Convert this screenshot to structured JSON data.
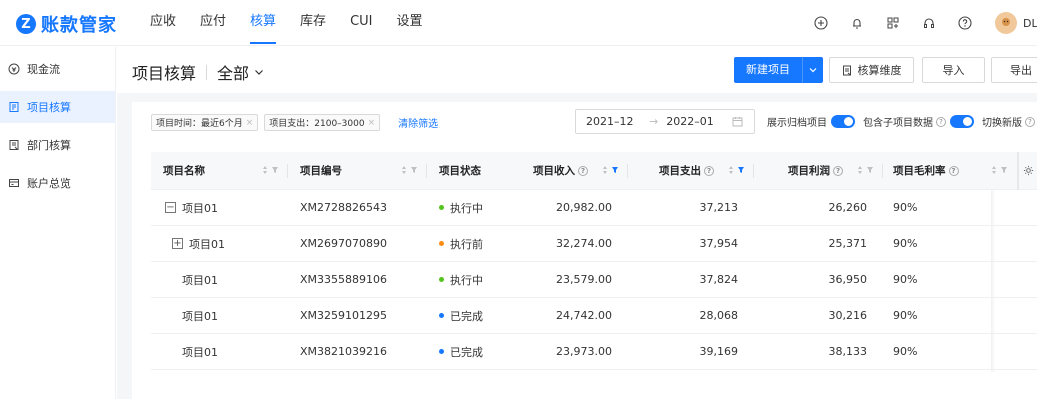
{
  "app": {
    "logo_letter": "Z",
    "title": "账款管家",
    "brand_color": "#1677ff"
  },
  "nav": {
    "items": [
      "应收",
      "应付",
      "核算",
      "库存",
      "CUI",
      "设置"
    ],
    "active": "核算"
  },
  "user": {
    "name": "DL"
  },
  "sidebar": {
    "items": [
      {
        "label": "现金流",
        "icon": "cash-icon"
      },
      {
        "label": "项目核算",
        "icon": "project-icon",
        "active": true
      },
      {
        "label": "部门核算",
        "icon": "department-icon"
      },
      {
        "label": "账户总览",
        "icon": "account-icon"
      }
    ]
  },
  "header": {
    "title": "项目核算",
    "scope": "全部",
    "new_button": "新建项目",
    "dimension_button": "核算维度",
    "import_button": "导入",
    "export_button": "导出"
  },
  "filters": {
    "chips": [
      "项目时间：最近6个月",
      "项目支出：2100–3000"
    ],
    "clear": "清除筛选"
  },
  "date_range": {
    "start": "2021–12",
    "end": "2022–01"
  },
  "switches": {
    "archived": "展示归档项目",
    "include_children": "包含子项目数据",
    "new_version": "切换新版"
  },
  "table": {
    "headers": [
      "项目名称",
      "项目编号",
      "项目状态",
      "项目收入",
      "项目支出",
      "项目利润",
      "项目毛利率"
    ],
    "rows": [
      {
        "name": "项目01",
        "code": "XM2728826543",
        "status": "执行中",
        "status_color": "#52c41a",
        "income": "20,982.00",
        "expense": "37,213",
        "profit": "26,260",
        "margin": "90%",
        "expander": "−",
        "indent": 0
      },
      {
        "name": "项目01",
        "code": "XM2697070890",
        "status": "执行前",
        "status_color": "#fa8c16",
        "income": "32,274.00",
        "expense": "37,954",
        "profit": "25,371",
        "margin": "90%",
        "expander": "+",
        "indent": 1
      },
      {
        "name": "项目01",
        "code": "XM3355889106",
        "status": "执行中",
        "status_color": "#52c41a",
        "income": "23,579.00",
        "expense": "37,824",
        "profit": "36,950",
        "margin": "90%",
        "expander": "",
        "indent": 2
      },
      {
        "name": "项目01",
        "code": "XM3259101295",
        "status": "已完成",
        "status_color": "#1677ff",
        "income": "24,742.00",
        "expense": "28,068",
        "profit": "30,216",
        "margin": "90%",
        "expander": "",
        "indent": 2
      },
      {
        "name": "项目01",
        "code": "XM3821039216",
        "status": "已完成",
        "status_color": "#1677ff",
        "income": "23,973.00",
        "expense": "39,169",
        "profit": "38,133",
        "margin": "90%",
        "expander": "",
        "indent": 2
      }
    ]
  }
}
